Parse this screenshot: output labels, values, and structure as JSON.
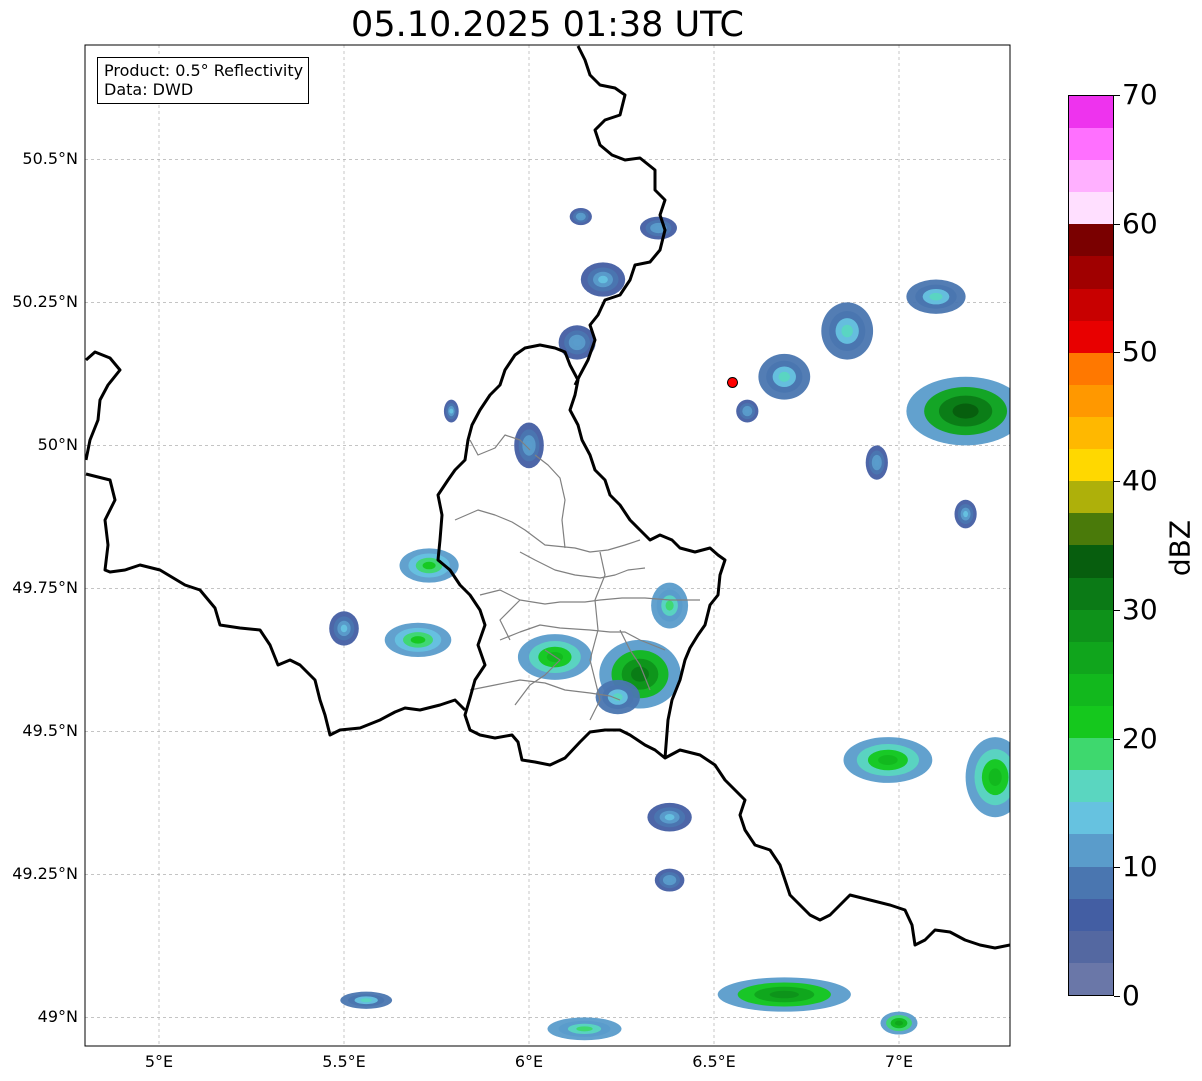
{
  "title": "05.10.2025 01:38 UTC",
  "info": {
    "product": "Product: 0.5° Reflectivity",
    "data": "Data: DWD"
  },
  "map": {
    "lon_range": [
      4.8,
      7.3
    ],
    "lat_range": [
      48.95,
      50.7
    ],
    "lat_ticks": [
      {
        "value": 50.5,
        "label": "50.5°N"
      },
      {
        "value": 50.25,
        "label": "50.25°N"
      },
      {
        "value": 50.0,
        "label": "50°N"
      },
      {
        "value": 49.75,
        "label": "49.75°N"
      },
      {
        "value": 49.5,
        "label": "49.5°N"
      },
      {
        "value": 49.25,
        "label": "49.25°N"
      },
      {
        "value": 49.0,
        "label": "49°N"
      }
    ],
    "lon_ticks": [
      {
        "value": 5.0,
        "label": "5°E"
      },
      {
        "value": 5.5,
        "label": "5.5°E"
      },
      {
        "value": 6.0,
        "label": "6°E"
      },
      {
        "value": 6.5,
        "label": "6.5°E"
      },
      {
        "value": 7.0,
        "label": "7°E"
      }
    ],
    "radar_site": {
      "lon": 6.55,
      "lat": 50.11,
      "color": "#ff0000"
    },
    "grid": true
  },
  "colorbar": {
    "label": "dBZ",
    "min": 0,
    "max": 70,
    "ticks": [
      0,
      10,
      20,
      30,
      40,
      50,
      60,
      70
    ],
    "colors": [
      "#6a77a8",
      "#5468a1",
      "#435ea3",
      "#4a76b0",
      "#5a9ccb",
      "#66c2e0",
      "#5ad6c0",
      "#3ed86e",
      "#15c81d",
      "#12b81d",
      "#10a51c",
      "#0e921a",
      "#0b7a16",
      "#075e0e",
      "#4a7a0a",
      "#aeb00a",
      "#ffd800",
      "#ffb800",
      "#ff9800",
      "#ff7800",
      "#e80000",
      "#c80000",
      "#a00000",
      "#7a0000",
      "#ffdfff",
      "#ffb0ff",
      "#ff70ff",
      "#ee33ee"
    ]
  },
  "echoes": [
    {
      "lon": 6.3,
      "lat": 49.6,
      "rx": 0.11,
      "ry": 0.06,
      "level": 12
    },
    {
      "lon": 6.24,
      "lat": 49.56,
      "rx": 0.06,
      "ry": 0.03,
      "level": 6
    },
    {
      "lon": 6.07,
      "lat": 49.63,
      "rx": 0.1,
      "ry": 0.04,
      "level": 9
    },
    {
      "lon": 5.7,
      "lat": 49.66,
      "rx": 0.09,
      "ry": 0.03,
      "level": 8
    },
    {
      "lon": 5.5,
      "lat": 49.68,
      "rx": 0.04,
      "ry": 0.03,
      "level": 5
    },
    {
      "lon": 5.73,
      "lat": 49.79,
      "rx": 0.08,
      "ry": 0.03,
      "level": 8
    },
    {
      "lon": 6.38,
      "lat": 49.72,
      "rx": 0.05,
      "ry": 0.04,
      "level": 7
    },
    {
      "lon": 6.97,
      "lat": 49.45,
      "rx": 0.12,
      "ry": 0.04,
      "level": 9
    },
    {
      "lon": 7.26,
      "lat": 49.42,
      "rx": 0.08,
      "ry": 0.07,
      "level": 9
    },
    {
      "lon": 7.18,
      "lat": 50.06,
      "rx": 0.16,
      "ry": 0.06,
      "level": 13
    },
    {
      "lon": 6.86,
      "lat": 50.2,
      "rx": 0.07,
      "ry": 0.05,
      "level": 6
    },
    {
      "lon": 7.1,
      "lat": 50.26,
      "rx": 0.08,
      "ry": 0.03,
      "level": 6
    },
    {
      "lon": 6.69,
      "lat": 50.12,
      "rx": 0.07,
      "ry": 0.04,
      "level": 6
    },
    {
      "lon": 6.69,
      "lat": 49.04,
      "rx": 0.18,
      "ry": 0.03,
      "level": 11
    },
    {
      "lon": 7.0,
      "lat": 48.99,
      "rx": 0.05,
      "ry": 0.02,
      "level": 10
    },
    {
      "lon": 6.15,
      "lat": 48.98,
      "rx": 0.1,
      "ry": 0.02,
      "level": 7
    },
    {
      "lon": 5.56,
      "lat": 49.03,
      "rx": 0.07,
      "ry": 0.015,
      "level": 6
    },
    {
      "lon": 6.38,
      "lat": 49.35,
      "rx": 0.06,
      "ry": 0.025,
      "level": 5
    },
    {
      "lon": 6.38,
      "lat": 49.24,
      "rx": 0.04,
      "ry": 0.02,
      "level": 4
    },
    {
      "lon": 6.59,
      "lat": 50.06,
      "rx": 0.03,
      "ry": 0.02,
      "level": 4
    },
    {
      "lon": 6.35,
      "lat": 50.38,
      "rx": 0.05,
      "ry": 0.02,
      "level": 4
    },
    {
      "lon": 6.2,
      "lat": 50.29,
      "rx": 0.06,
      "ry": 0.03,
      "level": 5
    },
    {
      "lon": 6.13,
      "lat": 50.18,
      "rx": 0.05,
      "ry": 0.03,
      "level": 4
    },
    {
      "lon": 6.0,
      "lat": 50.0,
      "rx": 0.04,
      "ry": 0.04,
      "level": 4
    },
    {
      "lon": 5.79,
      "lat": 50.06,
      "rx": 0.02,
      "ry": 0.02,
      "level": 5
    },
    {
      "lon": 6.14,
      "lat": 50.4,
      "rx": 0.03,
      "ry": 0.015,
      "level": 4
    },
    {
      "lon": 6.94,
      "lat": 49.97,
      "rx": 0.03,
      "ry": 0.03,
      "level": 4
    },
    {
      "lon": 7.18,
      "lat": 49.88,
      "rx": 0.03,
      "ry": 0.025,
      "level": 5
    }
  ]
}
